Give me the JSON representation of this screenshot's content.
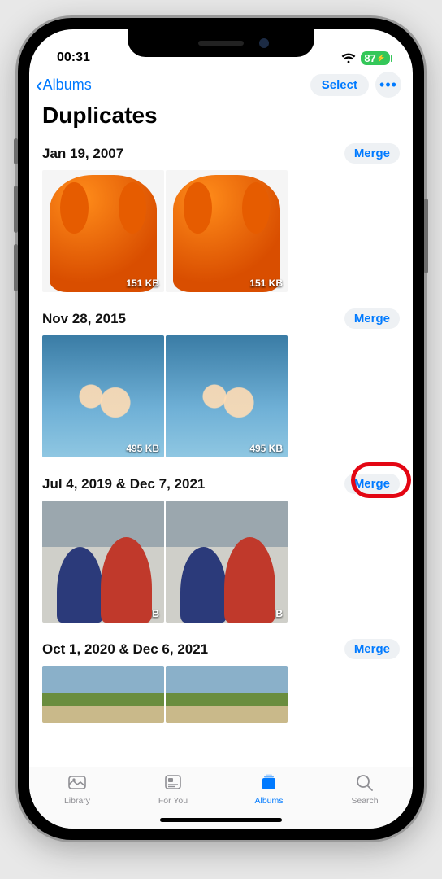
{
  "status": {
    "time": "00:31",
    "battery": "87"
  },
  "nav": {
    "back": "Albums",
    "select": "Select"
  },
  "title": "Duplicates",
  "merge_label": "Merge",
  "groups": [
    {
      "date": "Jan 19, 2007",
      "sizes": [
        "151 KB",
        "151 KB"
      ],
      "kind": "orange"
    },
    {
      "date": "Nov 28, 2015",
      "sizes": [
        "495 KB",
        "495 KB"
      ],
      "kind": "sky"
    },
    {
      "date": "Jul 4, 2019 & Dec 7, 2021",
      "sizes": [
        "2.3 MB",
        "76 KB"
      ],
      "kind": "couple",
      "highlight": true
    },
    {
      "date": "Oct 1, 2020 & Dec 6, 2021",
      "sizes": [
        "",
        ""
      ],
      "kind": "land",
      "short": true
    }
  ],
  "tabs": {
    "library": "Library",
    "foryou": "For You",
    "albums": "Albums",
    "search": "Search"
  }
}
